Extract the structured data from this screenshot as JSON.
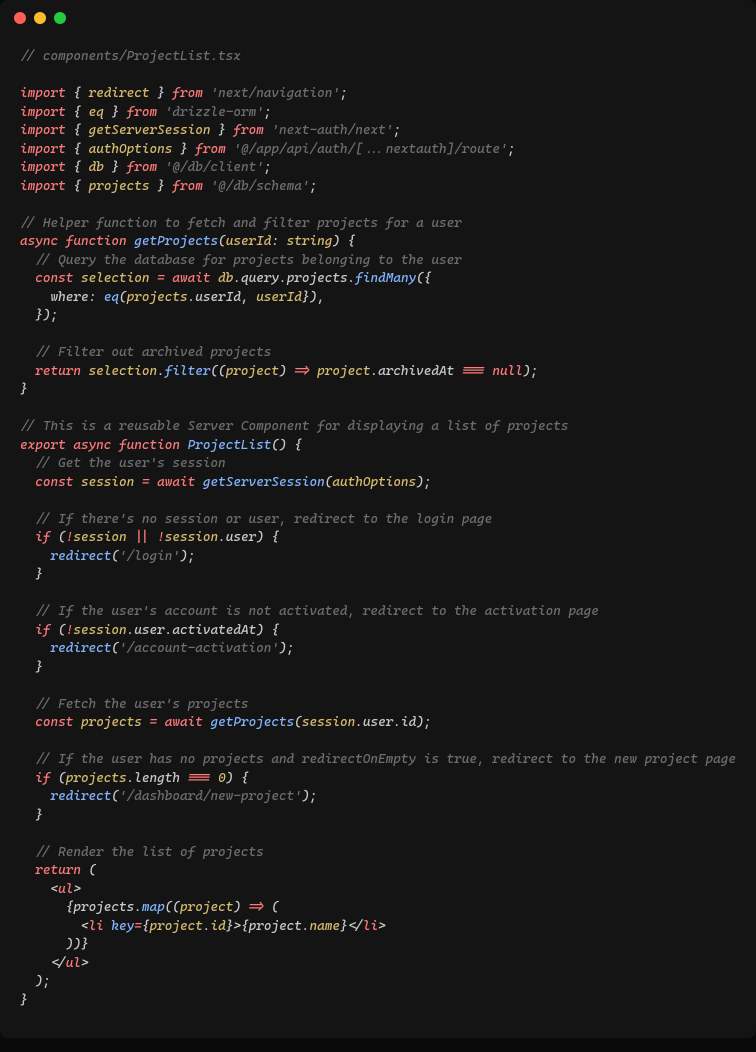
{
  "file_comment": "// components/ProjectList.tsx",
  "imports": [
    {
      "kw": "import",
      "open": "{",
      "name": "redirect",
      "close": "}",
      "from": "from",
      "mod": "'next/navigation'",
      "semi": ";"
    },
    {
      "kw": "import",
      "open": "{",
      "name": "eq",
      "close": "}",
      "from": "from",
      "mod": "'drizzle-orm'",
      "semi": ";"
    },
    {
      "kw": "import",
      "open": "{",
      "name": "getServerSession",
      "close": "}",
      "from": "from",
      "mod": "'next-auth/next'",
      "semi": ";"
    },
    {
      "kw": "import",
      "open": "{",
      "name": "authOptions",
      "close": "}",
      "from": "from",
      "mod": "'@/app/api/auth/[...nextauth]/route'",
      "semi": ";"
    },
    {
      "kw": "import",
      "open": "{",
      "name": "db",
      "close": "}",
      "from": "from",
      "mod": "'@/db/client'",
      "semi": ";"
    },
    {
      "kw": "import",
      "open": "{",
      "name": "projects",
      "close": "}",
      "from": "from",
      "mod": "'@/db/schema'",
      "semi": ";"
    }
  ],
  "c_helper": "// Helper function to fetch and filter projects for a user",
  "l_async": "async",
  "l_function": "function",
  "fn_getProjects": "getProjects",
  "p_open": "(",
  "arg_userId": "userId",
  "colon": ":",
  "ty_string": "string",
  "p_close_brace": ") {",
  "c_query": "// Query the database for projects belonging to the user",
  "l_const": "const",
  "v_selection": "selection",
  "eq": "=",
  "l_await": "await",
  "v_db": "db",
  "dot": ".",
  "v_query": "query",
  "v_projects": "projects",
  "m_findMany": "findMany",
  "open_call": "({",
  "k_where": "where",
  "v_eq": "eq",
  "v_userId": "userId",
  "comma": ",",
  "close_call": "}),",
  "close_stmt": "});",
  "c_filter": "// Filter out archived projects",
  "l_return": "return",
  "m_filter": "filter",
  "arrow_open": "((",
  "v_project": "project",
  "arrow_close": ")",
  "arrow": "=>",
  "v_archivedAt": "archivedAt",
  "triple_eq": "===",
  "l_null": "null",
  "end": ");",
  "brace_close": "}",
  "c_component": "// This is a reusable Server Component for displaying a list of projects",
  "l_export": "export",
  "fn_ProjectList": "ProjectList",
  "empty_parens": "()",
  "open_brace": "{",
  "c_session": "// Get the user's session",
  "v_session": "session",
  "fn_getServerSession": "getServerSession",
  "v_authOptions": "authOptions",
  "c_nosession": "// If there's no session or user, redirect to the login page",
  "l_if": "if",
  "bang": "!",
  "or": "||",
  "v_user": "user",
  "fn_redirect": "redirect",
  "str_login": "'/login'",
  "c_activated": "// If the user's account is not activated, redirect to the activation page",
  "v_activatedAt": "activatedAt",
  "str_activation": "'/account-activation'",
  "c_fetch": "// Fetch the user's projects",
  "v_projectsVar": "projects",
  "fn_getProjectsCall": "getProjects",
  "v_id": "id",
  "c_empty": "// If the user has no projects and redirectOnEmpty is true, redirect to the new project page",
  "v_length": "length",
  "zero": "0",
  "str_newproject": "'/dashboard/new-project'",
  "c_render": "// Render the list of projects",
  "paren_open": "(",
  "t_ul": "ul",
  "lt": "<",
  "gt": ">",
  "lt_close": "</",
  "m_map": "map",
  "t_li": "li",
  "a_key": "key",
  "v_name": "name",
  "jsx_close": "))}",
  "semi_end": ");"
}
